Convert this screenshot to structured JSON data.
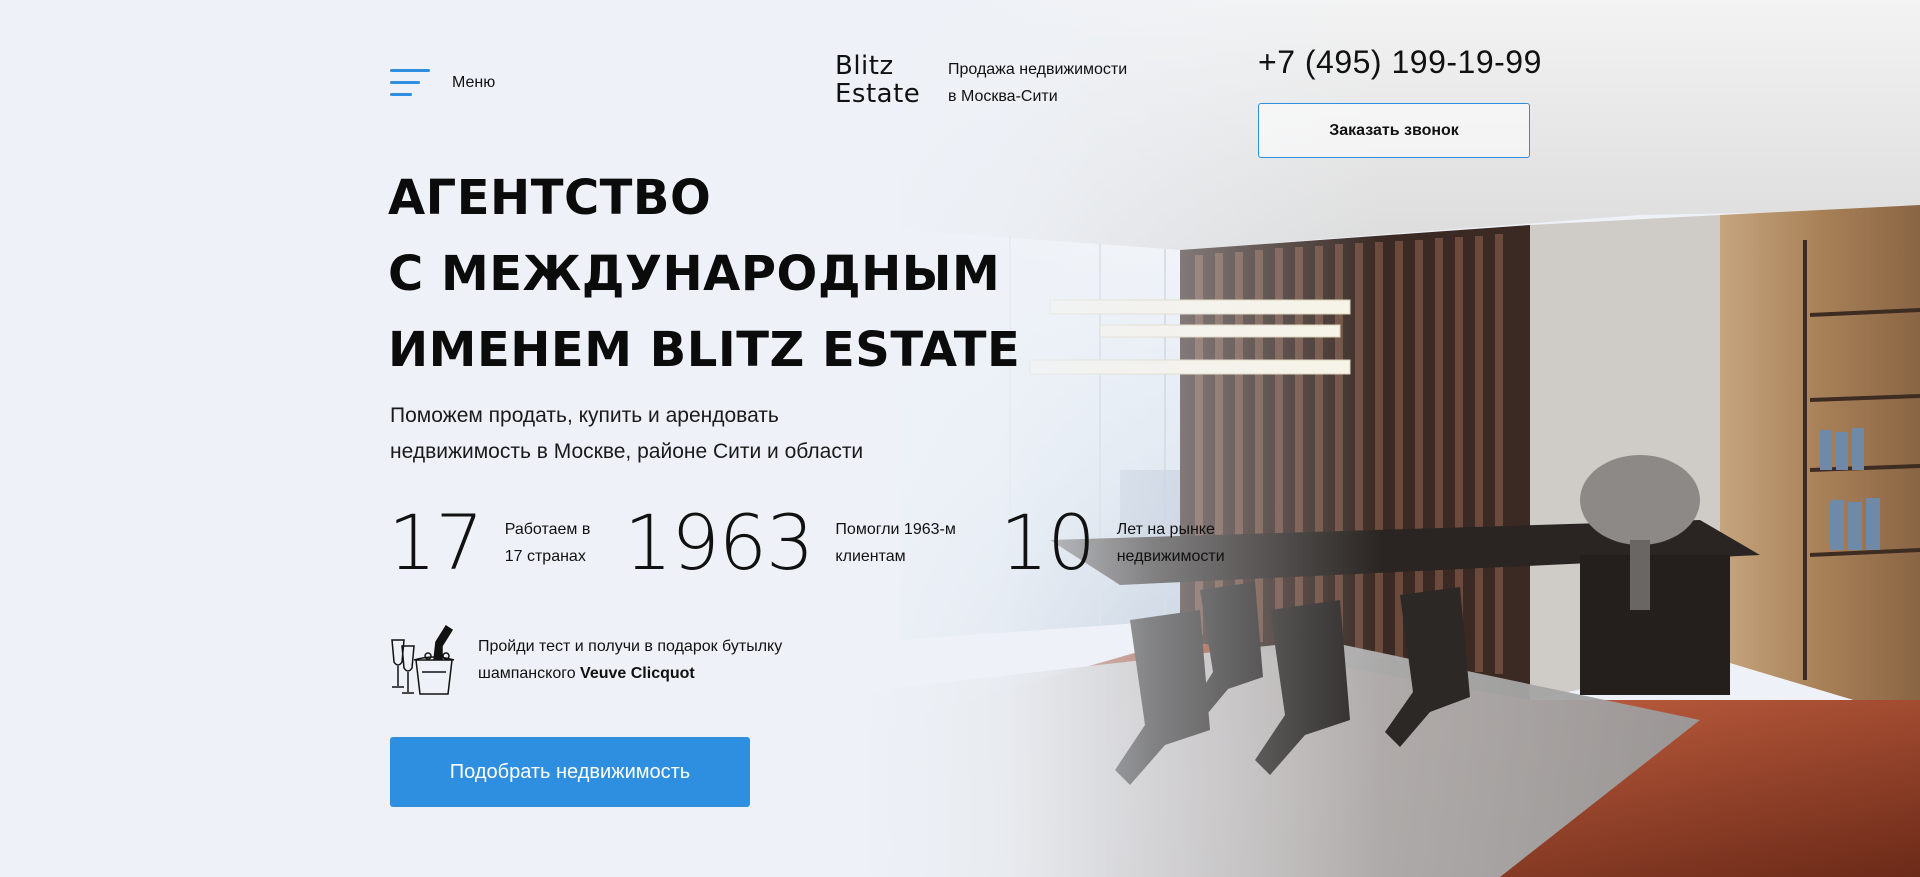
{
  "header": {
    "menu_label": "Меню",
    "logo_line1": "Blitz",
    "logo_line2": "Estate",
    "tagline_line1": "Продажа недвижимости",
    "tagline_line2": "в Москва-Сити",
    "phone": "+7 (495) 199-19-99",
    "callback_label": "Заказать звонок"
  },
  "hero": {
    "headline_lines": [
      "АГЕНТСТВО",
      "С МЕЖДУНАРОДНЫМ",
      "ИМЕНЕМ BLITZ ESTATE"
    ],
    "subtitle_line1": "Поможем продать, купить и арендовать",
    "subtitle_line2": "недвижимость в Москве, районе Сити и области",
    "stats": [
      {
        "value": "17",
        "label_line1": "Работаем в",
        "label_line2": "17 странах"
      },
      {
        "value": "1963",
        "label_line1": "Помогли 1963-м",
        "label_line2": "клиентам"
      },
      {
        "value": "10",
        "label_line1": "Лет на рынке",
        "label_line2": "недвижимости"
      }
    ],
    "promo_line1": "Пройди тест и получи в подарок бутылку",
    "promo_line2_prefix": "шампанского ",
    "promo_line2_bold": "Veuve Clicquot",
    "cta_label": "Подобрать недвижимость"
  },
  "colors": {
    "accent": "#2e8fe0",
    "background": "#eef2f8"
  },
  "icons": {
    "menu": "hamburger-icon",
    "logo": "blitz-estate-logo",
    "promo": "champagne-icon"
  }
}
